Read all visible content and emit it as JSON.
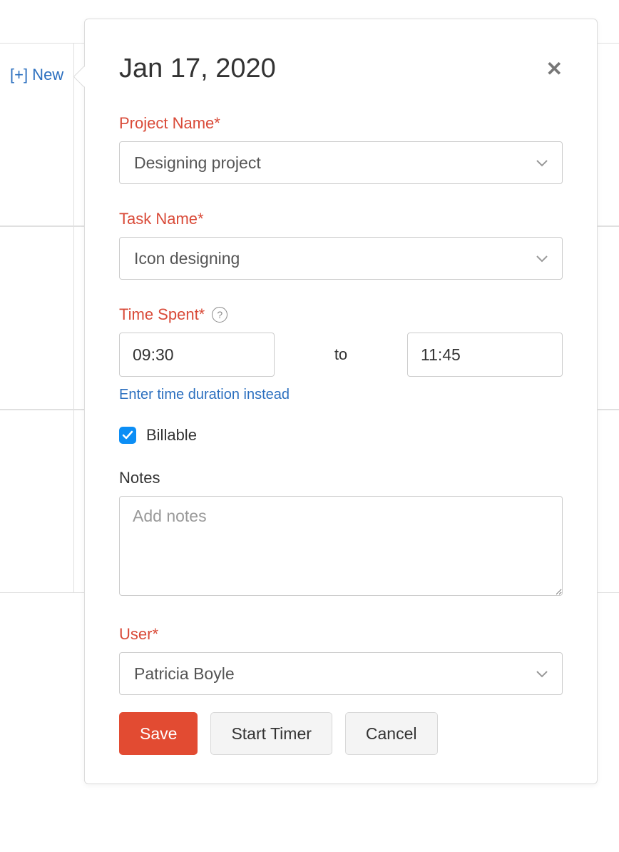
{
  "sidebar": {
    "new_label": "[+] New"
  },
  "popup": {
    "title": "Jan 17, 2020",
    "project": {
      "label": "Project Name*",
      "value": "Designing project"
    },
    "task": {
      "label": "Task Name*",
      "value": "Icon designing"
    },
    "time": {
      "label": "Time Spent*",
      "from": "09:30",
      "to_label": "to",
      "to": "11:45",
      "duration_link": "Enter time duration instead"
    },
    "billable": {
      "label": "Billable",
      "checked": true
    },
    "notes": {
      "label": "Notes",
      "placeholder": "Add notes",
      "value": ""
    },
    "user": {
      "label": "User*",
      "value": "Patricia Boyle"
    },
    "buttons": {
      "save": "Save",
      "start_timer": "Start Timer",
      "cancel": "Cancel"
    },
    "help_icon": "?"
  }
}
